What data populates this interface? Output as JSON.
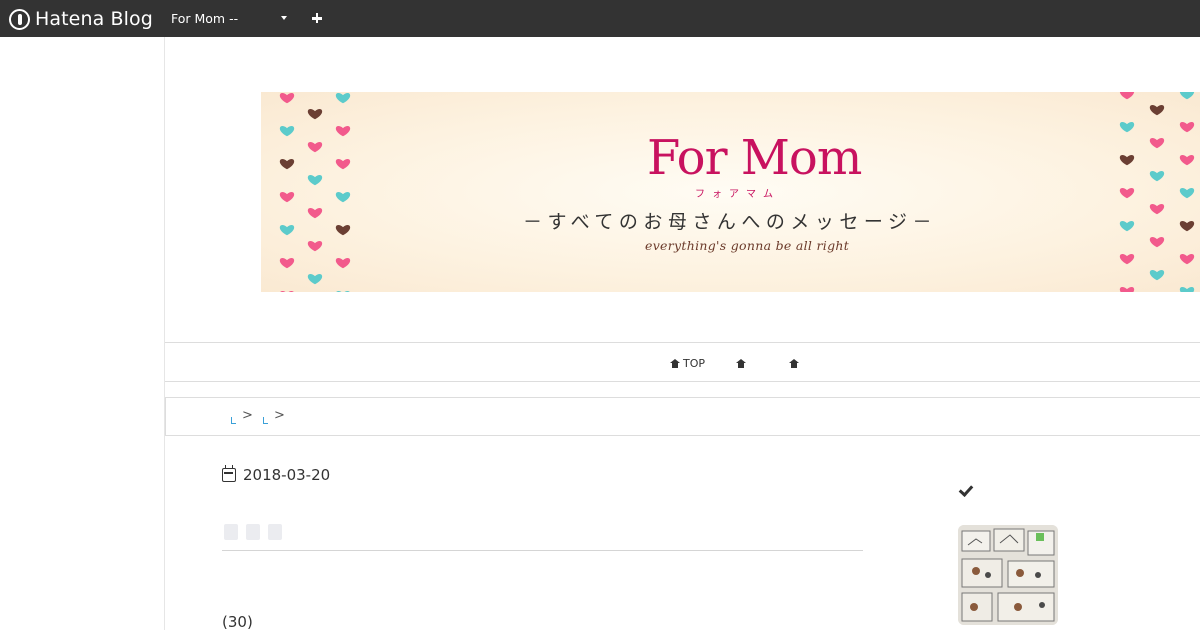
{
  "topbar": {
    "logo_text": "Hatena Blog",
    "blog_select": "For Mom --",
    "logo_icon": "hatena-logo-icon",
    "plus_icon": "plus-icon",
    "dropdown_icon": "caret-down-icon"
  },
  "banner": {
    "title": "For Mom",
    "kana": "フォアマム",
    "subtitle": "－すべてのお母さんへのメッセージ－",
    "tagline": "everything's gonna be all right",
    "colors": {
      "title": "#c8125f",
      "heart_pink": "#f25a8c",
      "heart_teal": "#5ccbcb",
      "heart_brown": "#6b3f33"
    }
  },
  "nav": {
    "items": [
      {
        "label": "TOP",
        "icon": "home-icon"
      },
      {
        "label": "",
        "icon": "home-icon"
      },
      {
        "label": "",
        "icon": "home-icon"
      }
    ]
  },
  "breadcrumb": {
    "separators": [
      ">",
      ">"
    ]
  },
  "article": {
    "date": "2018-03-20",
    "date_icon": "calendar-icon",
    "count": "(30)"
  },
  "sidebar": {
    "icon": "check-icon",
    "thumbnail_alt": "drawing-thumbnail"
  }
}
